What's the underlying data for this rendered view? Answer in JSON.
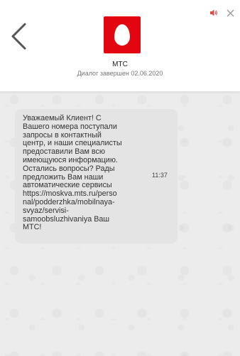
{
  "header": {
    "contact_name": "МТС",
    "dialog_status": "Диалог завершен 02.06.2020"
  },
  "icons": {
    "back": "chevron-left-icon",
    "logo": "mts-egg-logo",
    "sound": "speaker-icon",
    "close": "close-icon"
  },
  "colors": {
    "brand_red": "#e30611",
    "sound_icon": "#e04a4a",
    "bubble": "#e4e4e4",
    "background": "#ececec"
  },
  "messages": [
    {
      "text": "Уважаемый Клиент! С\nВашего номера поступали\nзапросы в контактный\nцентр, и наши специалисты\nпредоставили Вам всю\nимеющуюся информацию.\nОстались вопросы? Рады\nпредложить Вам наши\nавтоматические сервисы\nhttps://moskva.mts.ru/perso\nnal/podderzhka/mobilnaya-\nsvyaz/servisi-\nsamoobsluzhivaniya Ваш\nМТС!",
      "time": "11:37"
    }
  ]
}
